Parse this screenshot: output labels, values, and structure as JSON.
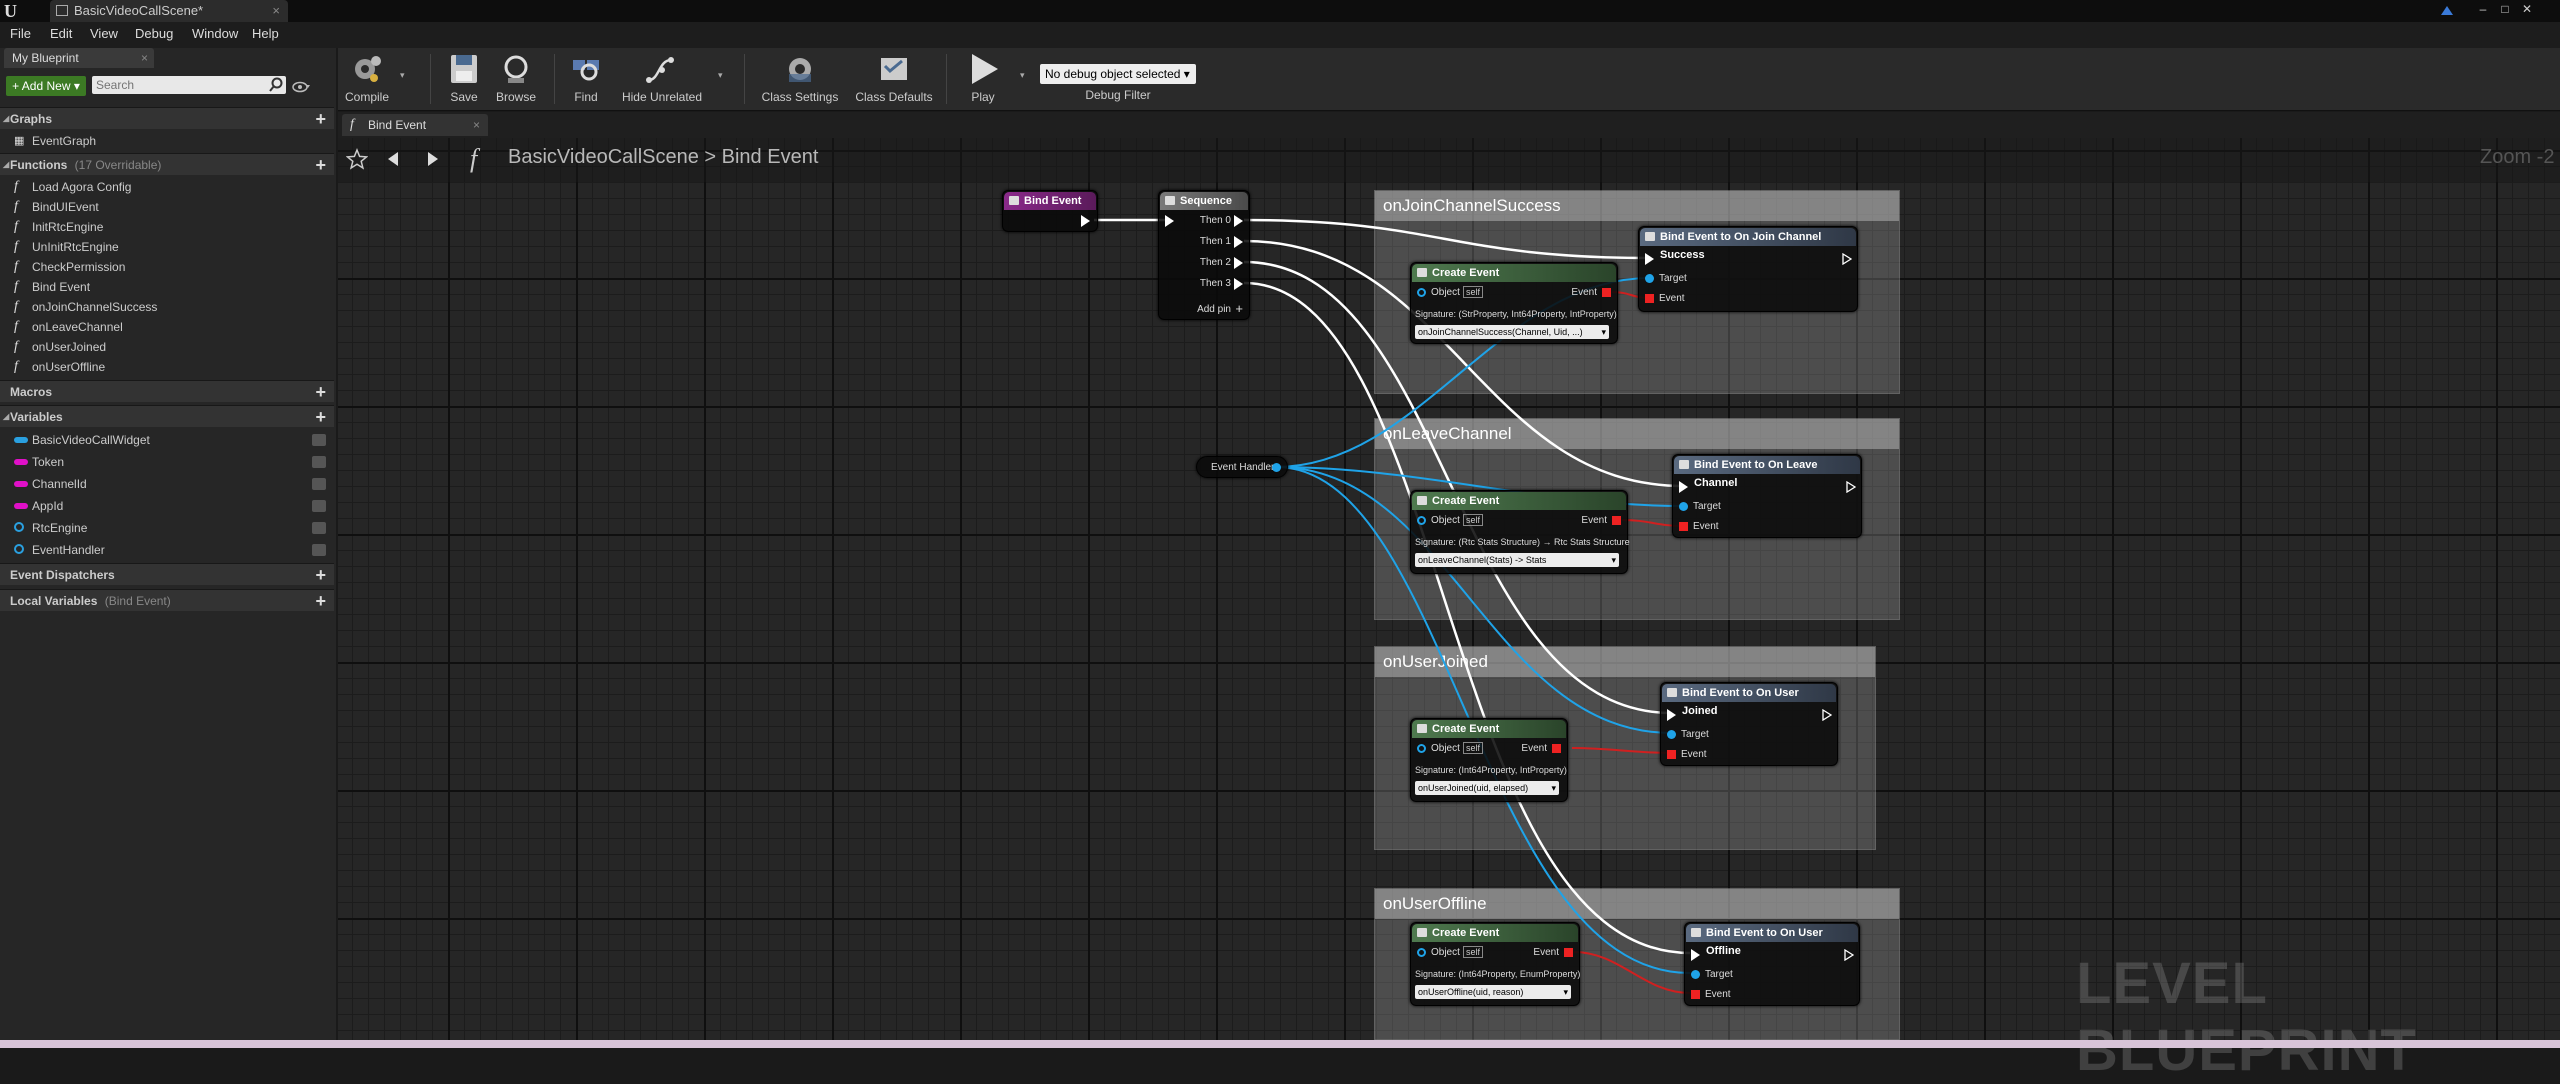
{
  "window": {
    "tab_title": "BasicVideoCallScene*",
    "controls": [
      "–",
      "□",
      "✕"
    ]
  },
  "menu": [
    "File",
    "Edit",
    "View",
    "Debug",
    "Window",
    "Help"
  ],
  "left_panel": {
    "tab": "My Blueprint",
    "add_new": "+ Add New ▾",
    "search_placeholder": "Search",
    "graphs_header": "Graphs",
    "graphs": [
      "EventGraph"
    ],
    "functions_header": "Functions",
    "functions_sub": "(17 Overridable)",
    "functions": [
      "Load Agora Config",
      "BindUIEvent",
      "InitRtcEngine",
      "UnInitRtcEngine",
      "CheckPermission",
      "Bind Event",
      "onJoinChannelSuccess",
      "onLeaveChannel",
      "onUserJoined",
      "onUserOffline"
    ],
    "macros_header": "Macros",
    "variables_header": "Variables",
    "variables": [
      {
        "name": "BasicVideoCallWidget",
        "type": "object-ref",
        "color": "#2aa0e0"
      },
      {
        "name": "Token",
        "type": "string",
        "color": "#e010c8"
      },
      {
        "name": "ChannelId",
        "type": "string",
        "color": "#e010c8"
      },
      {
        "name": "AppId",
        "type": "string",
        "color": "#e010c8"
      },
      {
        "name": "RtcEngine",
        "type": "object",
        "color": "#2aa0e0"
      },
      {
        "name": "EventHandler",
        "type": "object",
        "color": "#2aa0e0"
      }
    ],
    "dispatchers_header": "Event Dispatchers",
    "locals_header": "Local Variables",
    "locals_sub": "(Bind Event)"
  },
  "toolbar": {
    "compile": "Compile",
    "save": "Save",
    "browse": "Browse",
    "find": "Find",
    "hide_unrelated": "Hide Unrelated",
    "class_settings": "Class Settings",
    "class_defaults": "Class Defaults",
    "play": "Play",
    "debug_select": "No debug object selected ▾",
    "debug_filter": "Debug Filter"
  },
  "graph_tab": "Bind Event",
  "breadcrumb": "BasicVideoCallScene > Bind Event",
  "zoom": "Zoom -2",
  "watermark": "LEVEL BLUEPRINT",
  "nodes": {
    "bind_event": "Bind Event",
    "sequence": {
      "title": "Sequence",
      "pins": [
        "Then 0",
        "Then 1",
        "Then 2",
        "Then 3"
      ],
      "add_pin": "Add pin"
    },
    "event_handler": "Event Handler",
    "target": "Target",
    "event": "Event",
    "create_event": "Create Event",
    "object": "Object",
    "self": "self"
  },
  "comments": [
    {
      "title": "onJoinChannelSuccess",
      "bind_title": "Bind Event to On Join Channel Success",
      "signature": "Signature: (StrProperty, Int64Property, IntProperty)",
      "function": "onJoinChannelSuccess(Channel, Uid, ...)"
    },
    {
      "title": "onLeaveChannel",
      "bind_title": "Bind Event to On Leave Channel",
      "signature": "Signature: (Rtc Stats Structure) → Rtc Stats Structure",
      "function": "onLeaveChannel(Stats) -> Stats"
    },
    {
      "title": "onUserJoined",
      "bind_title": "Bind Event to On User Joined",
      "signature": "Signature: (Int64Property, IntProperty)",
      "function": "onUserJoined(uid, elapsed)"
    },
    {
      "title": "onUserOffline",
      "bind_title": "Bind Event to On User Offline",
      "signature": "Signature: (Int64Property, EnumProperty)",
      "function": "onUserOffline(uid, reason)"
    }
  ],
  "colors": {
    "function_header": "#8a2a8a",
    "create_event_header": "#3f6a3f",
    "bind_header": "#4a5a6e",
    "exec_wire": "#ffffff",
    "object_wire": "#1fa3e8",
    "event_wire": "#d02020"
  }
}
